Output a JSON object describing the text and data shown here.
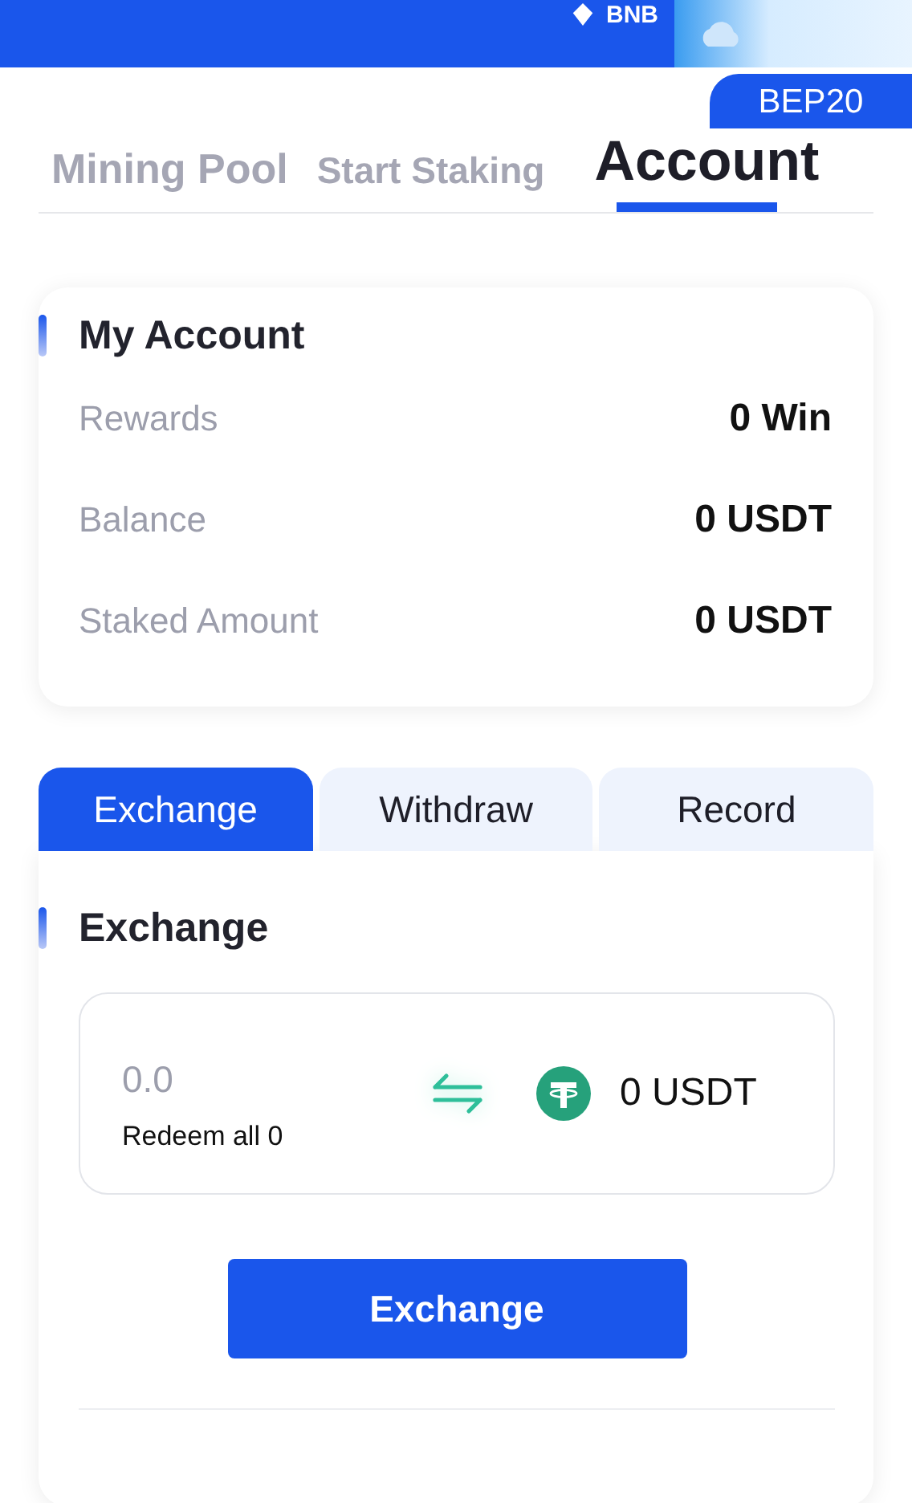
{
  "header": {
    "network": "BNB",
    "chain_badge": "BEP20"
  },
  "tabs": [
    {
      "label": "Mining Pool",
      "selected": false
    },
    {
      "label": "Start Staking",
      "selected": false
    },
    {
      "label": "Account",
      "selected": true
    }
  ],
  "account": {
    "title": "My Account",
    "rows": [
      {
        "label": "Rewards",
        "value": "0 Win"
      },
      {
        "label": "Balance",
        "value": "0 USDT"
      },
      {
        "label": "Staked Amount",
        "value": "0 USDT"
      }
    ]
  },
  "sub_tabs": [
    {
      "label": "Exchange",
      "selected": true
    },
    {
      "label": "Withdraw",
      "selected": false
    },
    {
      "label": "Record",
      "selected": false
    }
  ],
  "exchange": {
    "title": "Exchange",
    "placeholder": "0.0",
    "redeem_all": "Redeem all 0",
    "receive": "0 USDT",
    "button": "Exchange"
  }
}
